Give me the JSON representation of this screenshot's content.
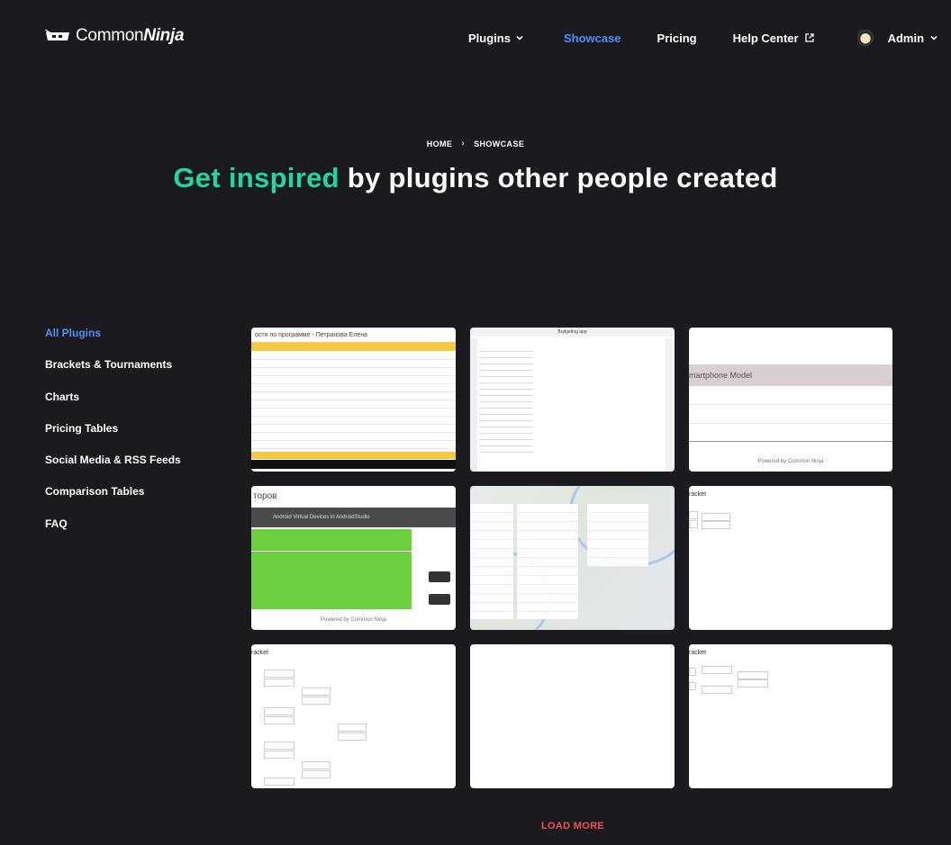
{
  "header": {
    "logo_text_light": "Common",
    "logo_text_bold": "Ninja",
    "nav": {
      "plugins": "Plugins",
      "showcase": "Showcase",
      "pricing": "Pricing",
      "help_center": "Help Center",
      "admin": "Admin"
    }
  },
  "breadcrumb": {
    "home": "HOME",
    "current": "SHOWCASE"
  },
  "hero": {
    "accent": "Get inspired",
    "rest": " by plugins other people created"
  },
  "sidebar": {
    "items": [
      {
        "label": "All Plugins",
        "active": true
      },
      {
        "label": "Brackets & Tournaments"
      },
      {
        "label": "Charts"
      },
      {
        "label": "Pricing Tables"
      },
      {
        "label": "Social Media & RSS Feeds"
      },
      {
        "label": "Comparison Tables"
      },
      {
        "label": "FAQ"
      }
    ]
  },
  "cards": [
    {
      "title": "ости по программе - Петранова Елена"
    },
    {
      "title": "Budgeting app"
    },
    {
      "label": "martphone Model",
      "powered": "Powered by Common Ninja"
    },
    {
      "title": "торов",
      "header": "Android Virtual Devices in AndroidStudio",
      "powered": "Powered by Common Ninja"
    },
    {},
    {
      "title": "racket"
    },
    {
      "title": "racket"
    },
    {},
    {
      "title": "racket"
    }
  ],
  "load_more": "LOAD MORE",
  "colors": {
    "accent_green": "#21d6a0",
    "link_blue": "#4f8ff7",
    "load_more": "#ef4f63",
    "background": "#1a1a1f"
  }
}
